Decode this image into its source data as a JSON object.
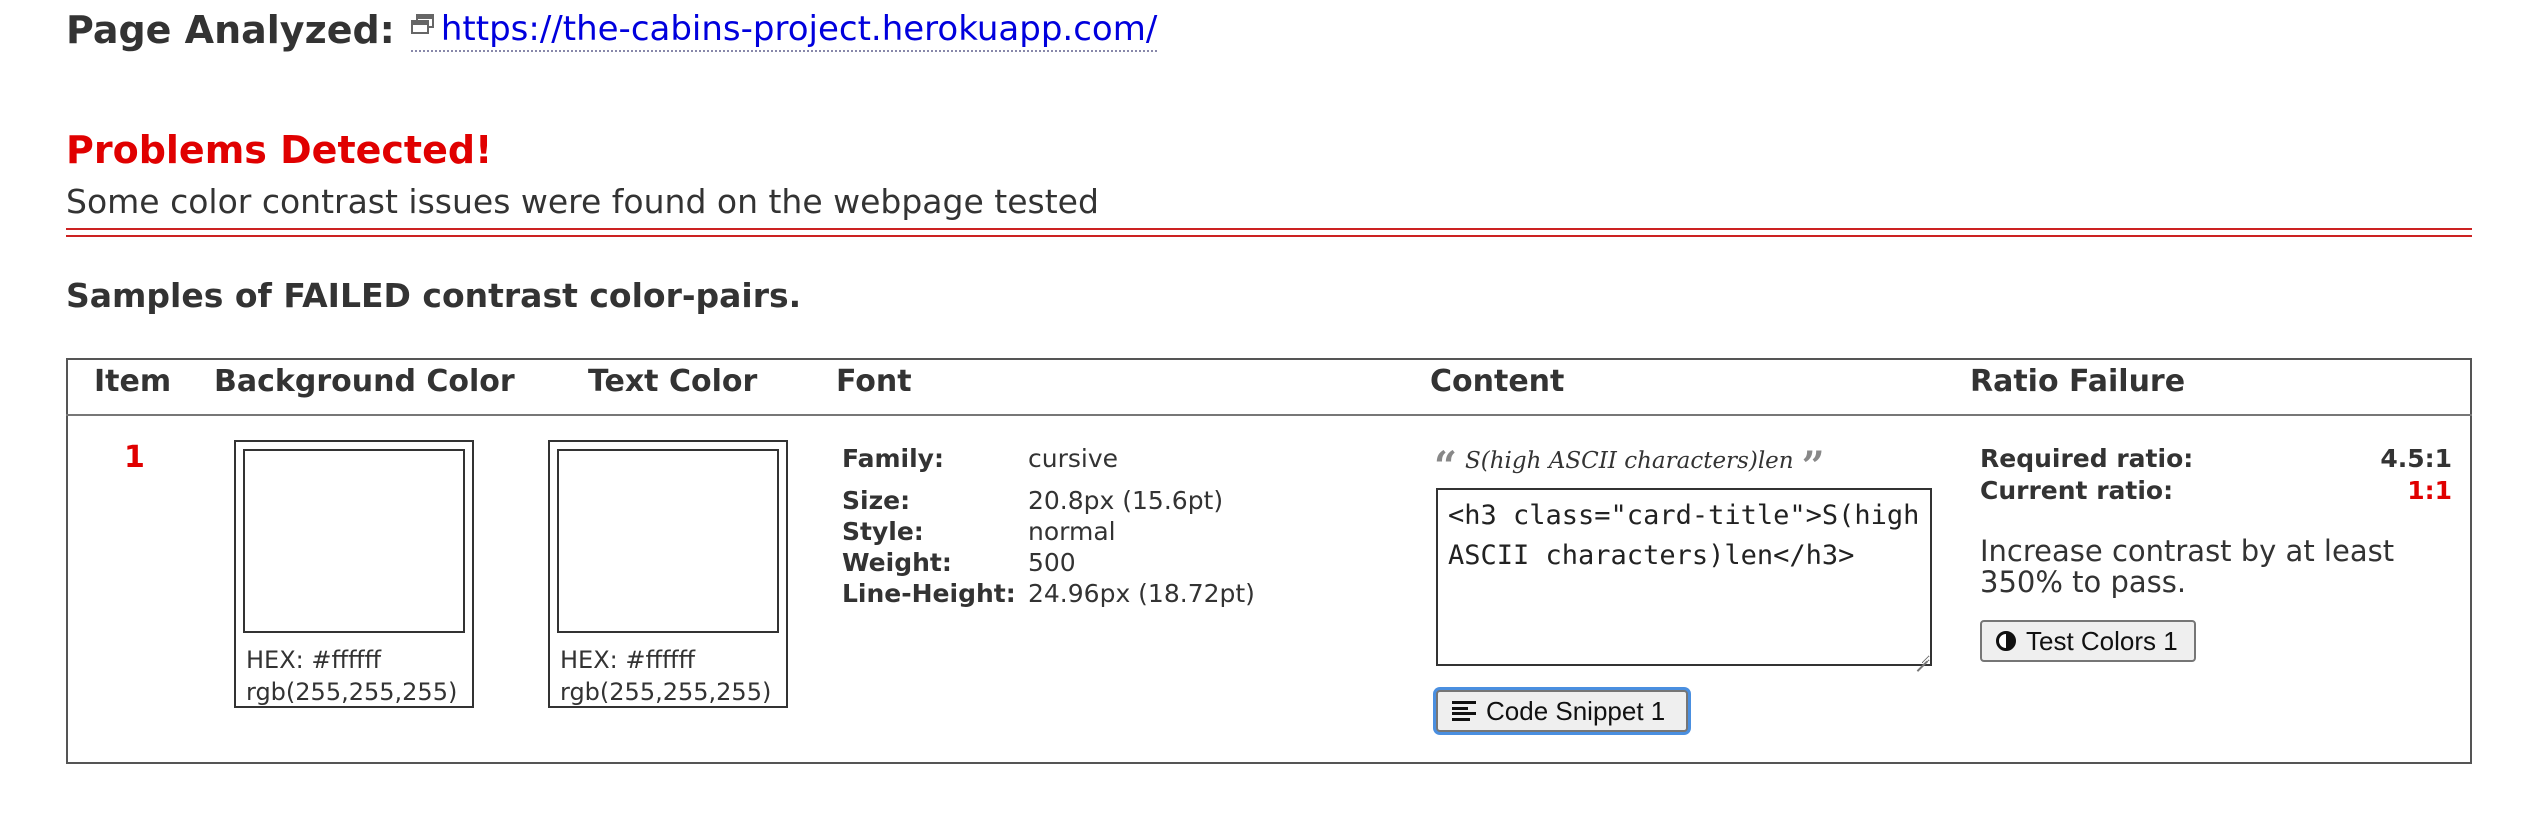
{
  "page_analyzed": {
    "label": "Page Analyzed:",
    "url": "https://the-cabins-project.herokuapp.com/",
    "icon": "external-link-icon"
  },
  "status": {
    "title": "Problems Detected!",
    "subtitle": "Some color contrast issues were found on the webpage tested"
  },
  "samples_heading": "Samples of FAILED contrast color-pairs.",
  "table": {
    "headers": [
      "Item",
      "Background Color",
      "Text Color",
      "Font",
      "Content",
      "Ratio Failure"
    ],
    "rows": [
      {
        "item": "1",
        "background": {
          "hex_label": "HEX: #ffffff",
          "rgb_label": "rgb(255,255,255)",
          "color": "#ffffff"
        },
        "text_color": {
          "hex_label": "HEX: #ffffff",
          "rgb_label": "rgb(255,255,255)",
          "color": "#ffffff"
        },
        "font": {
          "family_label": "Family:",
          "family": "cursive",
          "size_label": "Size:",
          "size": "20.8px (15.6pt)",
          "style_label": "Style:",
          "style": "normal",
          "weight_label": "Weight:",
          "weight": "500",
          "line_height_label": "Line-Height:",
          "line_height": "24.96px (18.72pt)"
        },
        "content": {
          "quote_text": "S(high ASCII characters)len",
          "snippet": "<h3 class=\"card-title\">S(high ASCII characters)len</h3>",
          "snippet_button": "Code Snippet 1"
        },
        "ratio": {
          "required_label": "Required ratio:",
          "required": "4.5:1",
          "current_label": "Current ratio:",
          "current": "1:1",
          "advice": "Increase contrast by at least 350% to pass.",
          "test_button": "Test Colors 1"
        }
      }
    ]
  },
  "colors": {
    "error_red": "#e00000",
    "link_blue": "#0000dd",
    "rule_red": "#cc2222",
    "focus_blue": "#4a8fe0"
  }
}
